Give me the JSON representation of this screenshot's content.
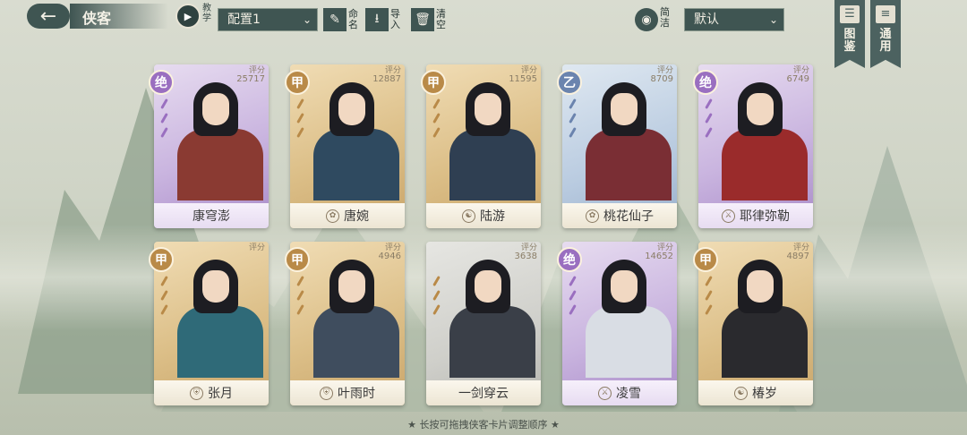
{
  "header": {
    "title": "侠客",
    "tutorial_label": "教学",
    "config_value": "配置1",
    "rename_label": "命名",
    "import_label": "导入",
    "clear_label": "清空",
    "simple_label": "简洁",
    "sort_value": "默认",
    "codex_label": "图鉴",
    "general_label": "通用"
  },
  "score_label": "评分",
  "cards": [
    {
      "name": "康穹澎",
      "grade": "绝",
      "score": "25717",
      "quality": "purple",
      "sect_icon": ""
    },
    {
      "name": "唐婉",
      "grade": "甲",
      "score": "12887",
      "quality": "gold",
      "sect_icon": "lotus-icon"
    },
    {
      "name": "陆游",
      "grade": "甲",
      "score": "11595",
      "quality": "gold",
      "sect_icon": "taiji-icon"
    },
    {
      "name": "桃花仙子",
      "grade": "乙",
      "score": "8709",
      "quality": "blue",
      "sect_icon": "lotus-icon"
    },
    {
      "name": "耶律弥勒",
      "grade": "绝",
      "score": "6749",
      "quality": "purple",
      "sect_icon": "sword-icon"
    },
    {
      "name": "张月",
      "grade": "甲",
      "score": "",
      "quality": "gold",
      "sect_icon": "shield-icon"
    },
    {
      "name": "叶雨时",
      "grade": "甲",
      "score": "4946",
      "quality": "gold",
      "sect_icon": "shield-icon"
    },
    {
      "name": "一剑穿云",
      "grade": "",
      "score": "3638",
      "quality": "gray",
      "sect_icon": ""
    },
    {
      "name": "凌雪",
      "grade": "绝",
      "score": "14652",
      "quality": "purple",
      "sect_icon": "sword-icon"
    },
    {
      "name": "椿岁",
      "grade": "甲",
      "score": "4897",
      "quality": "gold",
      "sect_icon": "taiji-icon"
    }
  ],
  "hint": "★ 长按可拖拽侠客卡片调整顺序 ★"
}
